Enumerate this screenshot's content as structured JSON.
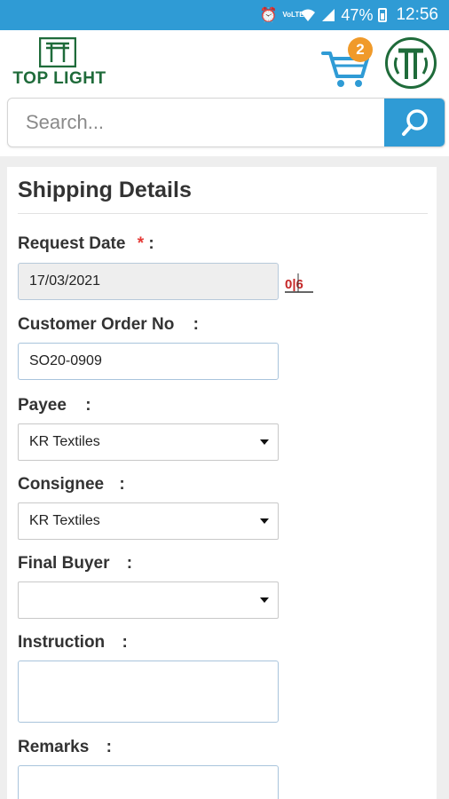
{
  "status_bar": {
    "battery": "47%",
    "time": "12:56",
    "network_label": "VoLTE"
  },
  "header": {
    "logo_text": "TOP LIGHT",
    "cart_count": "2",
    "brand_color": "#1f6b3a",
    "accent_color": "#2f9bd5",
    "badge_color": "#f09a2a"
  },
  "search": {
    "placeholder": "Search...",
    "value": ""
  },
  "form": {
    "title": "Shipping Details",
    "request_date": {
      "label": "Request Date",
      "required_mark": "*",
      "suffix": ":",
      "value": "17/03/2021",
      "calendar_glyph": "0|6"
    },
    "customer_order": {
      "label": "Customer Order No",
      "suffix": ":",
      "value": "SO20-0909"
    },
    "payee": {
      "label": "Payee",
      "suffix": ":",
      "value": "KR Textiles"
    },
    "consignee": {
      "label": "Consignee",
      "suffix": ":",
      "value": "KR Textiles"
    },
    "final_buyer": {
      "label": "Final Buyer",
      "suffix": ":",
      "value": ""
    },
    "instruction": {
      "label": "Instruction",
      "suffix": ":",
      "value": ""
    },
    "remarks": {
      "label": "Remarks",
      "suffix": ":",
      "value": ""
    }
  }
}
